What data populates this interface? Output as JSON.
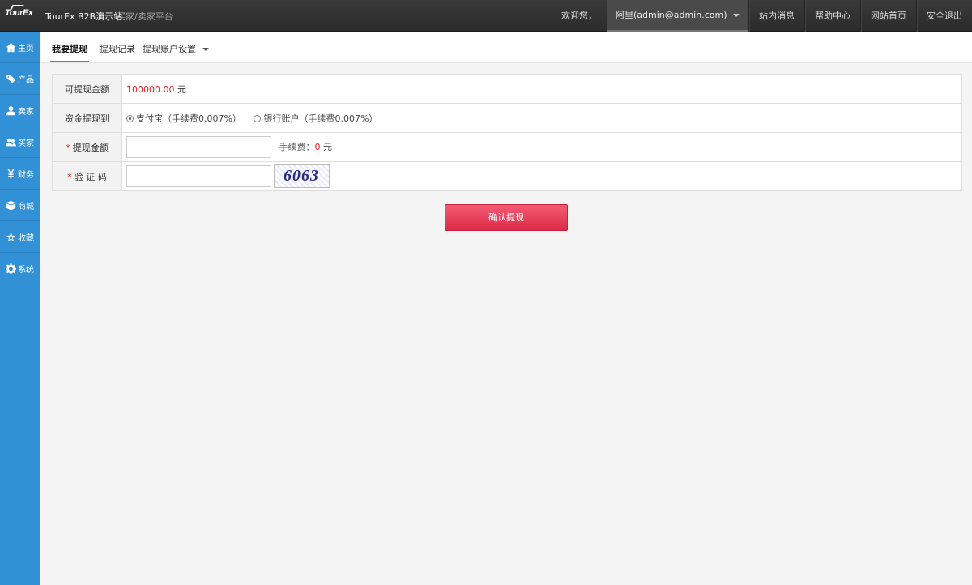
{
  "header": {
    "logo": "TourEx",
    "site_title": "TourEx B2B演示站",
    "site_sub": "买家/卖家平台",
    "welcome": "欢迎您，",
    "user": "阿里(admin@admin.com)",
    "nav": [
      "站内消息",
      "帮助中心",
      "网站首页",
      "安全退出"
    ]
  },
  "sidebar": {
    "items": [
      {
        "label": "主页",
        "icon": "home-icon"
      },
      {
        "label": "产品",
        "icon": "tag-icon"
      },
      {
        "label": "卖家",
        "icon": "user-icon"
      },
      {
        "label": "买家",
        "icon": "users-icon"
      },
      {
        "label": "财务",
        "icon": "yen-icon"
      },
      {
        "label": "商城",
        "icon": "box-icon"
      },
      {
        "label": "收藏",
        "icon": "star-icon"
      },
      {
        "label": "系统",
        "icon": "gear-icon"
      }
    ]
  },
  "subnav": {
    "tabs": [
      "我要提现",
      "提现记录",
      "提现账户设置"
    ],
    "active": "我要提现"
  },
  "form": {
    "balance_label": "可提现金额",
    "balance_value": "100000.00",
    "balance_unit": "元",
    "target_label": "资金提现到",
    "option_alipay": "支付宝（手续费0.007%）",
    "option_bank": "银行账户（手续费0.007%）",
    "selected_option": "支付宝",
    "amount_label": "提现金额",
    "amount_value": "",
    "fee_label": "手续费：",
    "fee_value": "0",
    "fee_unit": "元",
    "captcha_label": "验 证 码",
    "captcha_value": "",
    "captcha_image_text": "6063"
  },
  "submit_label": "确认提现",
  "colors": {
    "sidebar": "#3190d6",
    "accent_red": "#e0201e",
    "button": "#e23a55",
    "topbar": "#2f2f2f"
  }
}
